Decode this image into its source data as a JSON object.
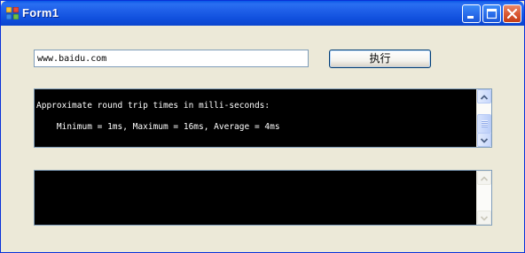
{
  "window": {
    "title": "Form1",
    "icon": "winforms-app-icon",
    "controls": [
      "minimize-icon",
      "maximize-icon",
      "close-icon"
    ]
  },
  "url_input": {
    "value": "www.baidu.com"
  },
  "execute_button": {
    "label": "执行"
  },
  "output_primary": {
    "lines": [
      "Approximate round trip times in milli-seconds:",
      "    Minimum = 1ms, Maximum = 16ms, Average = 4ms"
    ]
  },
  "output_secondary": {
    "lines": []
  },
  "colors": {
    "window_bg": "#ECE9D8",
    "titlebar": "#0A58E6",
    "output_bg": "#000000",
    "output_text": "#FFFFFF"
  }
}
